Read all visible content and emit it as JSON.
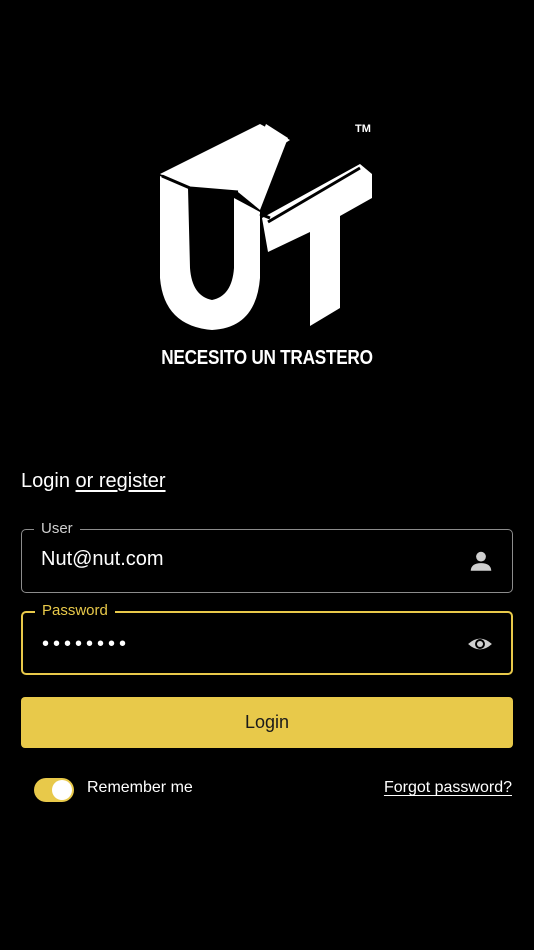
{
  "brand": {
    "logo_icon": "nut-logo-icon",
    "tagline": "NECESITO UN TRASTERO",
    "trademark": "TM"
  },
  "auth": {
    "heading_login": "Login",
    "heading_register": "or register"
  },
  "form": {
    "user": {
      "label": "User",
      "value": "Nut@nut.com",
      "icon": "person-icon"
    },
    "password": {
      "label": "Password",
      "value": "••••••••",
      "icon": "eye-icon"
    },
    "login_button": "Login",
    "remember_label": "Remember me",
    "remember_on": true,
    "forgot_link": "Forgot password?"
  },
  "colors": {
    "accent": "#e8c94a",
    "background": "#000000",
    "text": "#ffffff"
  }
}
